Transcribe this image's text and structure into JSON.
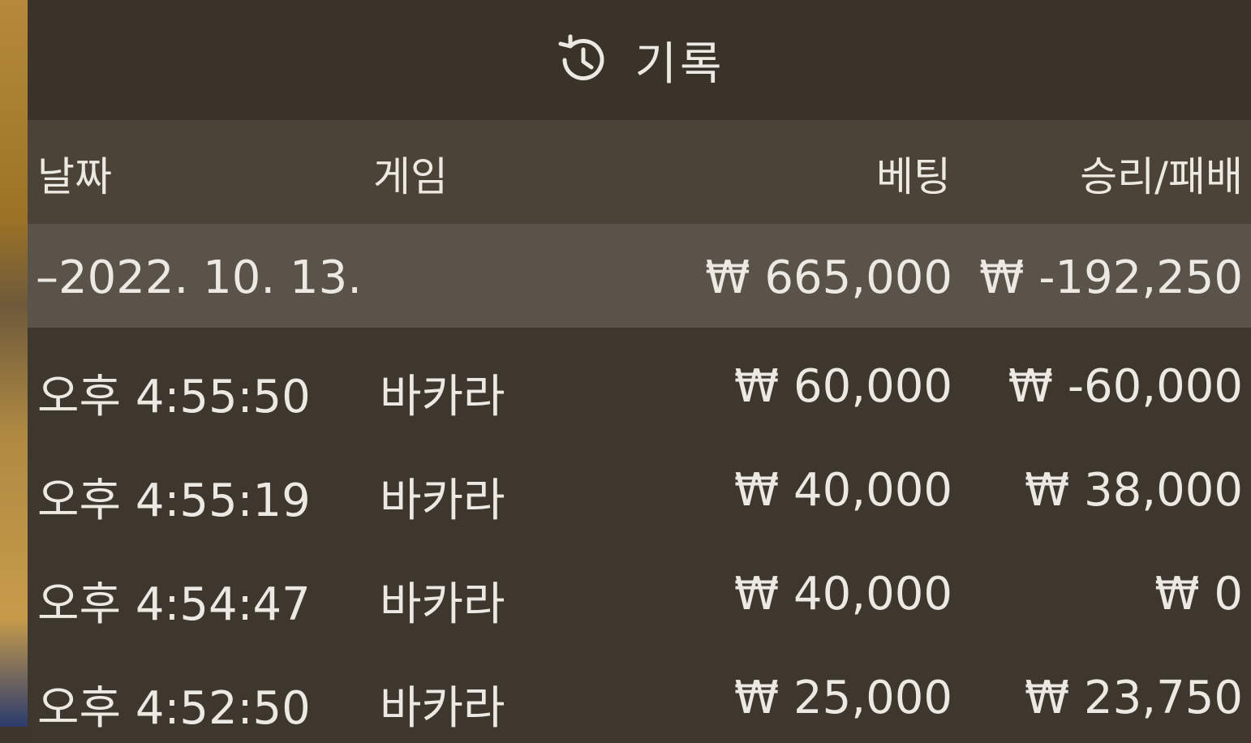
{
  "header": {
    "title": "기록",
    "icon": "history-icon"
  },
  "columns": {
    "date": "날짜",
    "game": "게임",
    "bet": "베팅",
    "result": "승리/패배"
  },
  "summary": {
    "date": "–2022. 10. 13.",
    "bet": "₩ 665,000",
    "result": "₩ -192,250"
  },
  "rows": [
    {
      "time": "오후 4:55:50",
      "game": "바카라",
      "bet": "₩ 60,000",
      "result": "₩ -60,000"
    },
    {
      "time": "오후 4:55:19",
      "game": "바카라",
      "bet": "₩ 40,000",
      "result": "₩ 38,000"
    },
    {
      "time": "오후 4:54:47",
      "game": "바카라",
      "bet": "₩ 40,000",
      "result": "₩ 0"
    },
    {
      "time": "오후 4:52:50",
      "game": "바카라",
      "bet": "₩ 25,000",
      "result": "₩ 23,750"
    }
  ]
}
